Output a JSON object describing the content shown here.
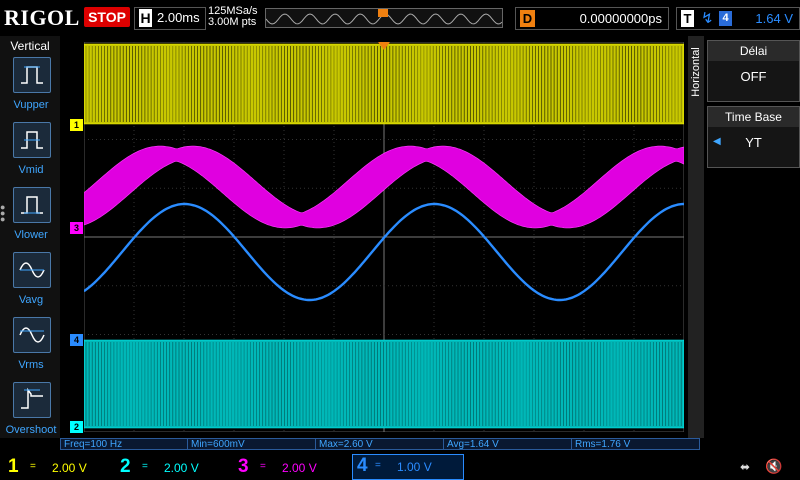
{
  "header": {
    "brand": "RIGOL",
    "run_state": "STOP",
    "timebase_label": "H",
    "timebase_value": "2.00ms",
    "sample_rate": "125MSa/s",
    "memory_depth": "3.00M pts",
    "delay_label": "D",
    "delay_value": "0.00000000ps",
    "trigger_label": "T",
    "trigger_source": "4",
    "trigger_level": "1.64 V"
  },
  "left_menu": {
    "title": "Vertical",
    "items": [
      {
        "label": "Vupper",
        "icon": "vupper-icon"
      },
      {
        "label": "Vmid",
        "icon": "vmid-icon"
      },
      {
        "label": "Vlower",
        "icon": "vlower-icon"
      },
      {
        "label": "Vavg",
        "icon": "vavg-icon"
      },
      {
        "label": "Vrms",
        "icon": "vrms-icon"
      },
      {
        "label": "Overshoot",
        "icon": "overshoot-icon"
      }
    ]
  },
  "right_menu": {
    "tab_label": "Horizontal",
    "items": [
      {
        "label": "Délai",
        "value": "OFF"
      },
      {
        "label": "Time Base",
        "value": "YT"
      }
    ]
  },
  "channels_markers": {
    "ch1": "1",
    "ch2": "2",
    "ch3": "3",
    "ch4": "4",
    "trigger": "T"
  },
  "measurements": [
    {
      "text": "Freq=100 Hz"
    },
    {
      "text": "Min=600mV"
    },
    {
      "text": "Max=2.60 V"
    },
    {
      "text": "Avg=1.64 V"
    },
    {
      "text": "Rms=1.76 V"
    }
  ],
  "channels": [
    {
      "number": "1",
      "coupling": "=",
      "scale": "2.00 V",
      "color": "#ffff00"
    },
    {
      "number": "2",
      "coupling": "=",
      "scale": "2.00 V",
      "color": "#00ffff"
    },
    {
      "number": "3",
      "coupling": "=",
      "scale": "2.00 V",
      "color": "#ff00ff"
    },
    {
      "number": "4",
      "coupling": "=",
      "scale": "1.00 V",
      "color": "#2a8cff"
    }
  ],
  "colors": {
    "ch1": "#e6e600",
    "ch2": "#00e6e6",
    "ch3": "#ff00ff",
    "ch4": "#2a8cff",
    "trigger": "#f08010",
    "menu_accent": "#3fa6ff",
    "stop": "#dd0000"
  }
}
